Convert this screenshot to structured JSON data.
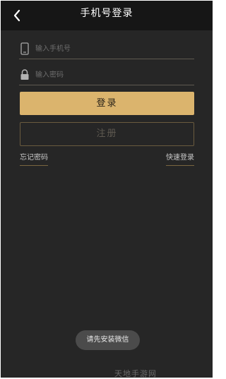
{
  "header": {
    "title": "手机号登录",
    "back_icon": "chevron-left-icon"
  },
  "form": {
    "phone": {
      "placeholder": "输入手机号",
      "value": "",
      "icon": "phone-icon"
    },
    "password": {
      "placeholder": "输入密码",
      "value": "",
      "icon": "lock-icon"
    },
    "login_label": "登录",
    "register_label": "注册",
    "forgot_label": "忘记密码",
    "quick_login_label": "快速登录"
  },
  "toast": {
    "text": "请先安装微信"
  },
  "watermark": "天地手游网",
  "colors": {
    "background": "#262626",
    "header": "#161616",
    "accent": "#dbb46d"
  }
}
